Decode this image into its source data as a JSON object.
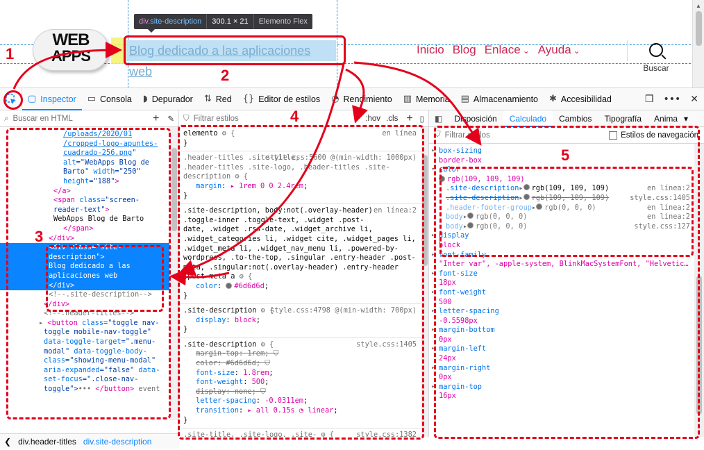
{
  "preview": {
    "logo_line1": "WEB",
    "logo_line2": "APPS",
    "site_description": "Blog dedicado a las aplicaciones web",
    "tooltip": {
      "tag": "div",
      "class": ".site-description",
      "size": "300.1 × 21",
      "type": "Elemento Flex"
    },
    "menu": [
      {
        "label": "Inicio",
        "has_arrow": false
      },
      {
        "label": "Blog",
        "has_arrow": false
      },
      {
        "label": "Enlace",
        "has_arrow": true
      },
      {
        "label": "Ayuda",
        "has_arrow": true
      }
    ],
    "search_label": "Buscar"
  },
  "toolbar": {
    "tabs": [
      {
        "label": "Inspector",
        "icon": "inspector-icon",
        "glyph": "▢",
        "active": true
      },
      {
        "label": "Consola",
        "icon": "console-icon",
        "glyph": "▭",
        "active": false
      },
      {
        "label": "Depurador",
        "icon": "debugger-icon",
        "glyph": "◗",
        "active": false
      },
      {
        "label": "Red",
        "icon": "network-icon",
        "glyph": "⇅",
        "active": false
      },
      {
        "label": "Editor de estilos",
        "icon": "style-editor-icon",
        "glyph": "{}",
        "active": false
      },
      {
        "label": "Rendimiento",
        "icon": "performance-icon",
        "glyph": "◔",
        "active": false
      },
      {
        "label": "Memoria",
        "icon": "memory-icon",
        "glyph": "▥",
        "active": false
      },
      {
        "label": "Almacenamiento",
        "icon": "storage-icon",
        "glyph": "▤",
        "active": false
      },
      {
        "label": "Accesibilidad",
        "icon": "accessibility-icon",
        "glyph": "✱",
        "active": false
      }
    ]
  },
  "html_panel": {
    "search_placeholder": "Buscar en HTML",
    "lines": [
      {
        "indent": 13,
        "parts": [
          {
            "t": "/uploads/2020/01",
            "c": "link-c"
          }
        ]
      },
      {
        "indent": 13,
        "parts": [
          {
            "t": "/cropped-logo-apuntes-",
            "c": "link-c"
          }
        ]
      },
      {
        "indent": 13,
        "parts": [
          {
            "t": "cuadrado-256.png",
            "c": "link-c"
          },
          {
            "t": "\"",
            "c": "val-c"
          }
        ]
      },
      {
        "indent": 13,
        "parts": [
          {
            "t": "alt",
            "c": "attr-c"
          },
          {
            "t": "=\"WebApps Blog de",
            "c": "val-c"
          }
        ]
      },
      {
        "indent": 13,
        "parts": [
          {
            "t": "Barto\"",
            "c": "val-c"
          },
          {
            "t": " width",
            "c": "attr-c"
          },
          {
            "t": "=\"250\"",
            "c": "val-c"
          }
        ]
      },
      {
        "indent": 13,
        "parts": [
          {
            "t": "height",
            "c": "attr-c"
          },
          {
            "t": "=\"188\"",
            "c": "val-c"
          },
          {
            "t": ">",
            "c": "tag-c"
          }
        ]
      },
      {
        "indent": 11,
        "parts": [
          {
            "t": "</a>",
            "c": "tag-c"
          }
        ]
      },
      {
        "indent": 11,
        "parts": [
          {
            "t": "<span ",
            "c": "tag-c"
          },
          {
            "t": "class",
            "c": "attr-c"
          },
          {
            "t": "=\"screen-",
            "c": "val-c"
          }
        ]
      },
      {
        "indent": 11,
        "parts": [
          {
            "t": "reader-text\"",
            "c": "val-c"
          },
          {
            "t": ">",
            "c": "tag-c"
          }
        ]
      },
      {
        "indent": 11,
        "parts": [
          {
            "t": "WebApps Blog de Barto",
            "c": "sel-c"
          }
        ]
      },
      {
        "indent": 13,
        "parts": [
          {
            "t": "</span>",
            "c": "tag-c"
          }
        ]
      },
      {
        "indent": 10,
        "parts": [
          {
            "t": "</div>",
            "c": "tag-c"
          }
        ]
      },
      {
        "indent": 10,
        "selected": true,
        "parts": [
          {
            "t": "<div class=\"site-",
            "c": ""
          }
        ]
      },
      {
        "indent": 10,
        "selected": true,
        "parts": [
          {
            "t": "description\">",
            "c": ""
          }
        ]
      },
      {
        "indent": 10,
        "selected": true,
        "parts": [
          {
            "t": "Blog dedicado a las",
            "c": ""
          }
        ]
      },
      {
        "indent": 10,
        "selected": true,
        "parts": [
          {
            "t": "aplicaciones web",
            "c": ""
          }
        ]
      },
      {
        "indent": 10,
        "selected": true,
        "parts": [
          {
            "t": "</div>",
            "c": ""
          }
        ]
      },
      {
        "indent": 10,
        "parts": [
          {
            "t": "<!--.site-description-->",
            "c": "gray-c"
          }
        ]
      },
      {
        "indent": 9,
        "parts": [
          {
            "t": "</div>",
            "c": "tag-c"
          }
        ]
      },
      {
        "indent": 9,
        "parts": [
          {
            "t": "<!--.header-titles-->",
            "c": "gray-c"
          }
        ]
      },
      {
        "indent": 8,
        "parts": [
          {
            "t": "▸ ",
            "c": "gray-c"
          },
          {
            "t": "<button ",
            "c": "tag-c"
          },
          {
            "t": "class",
            "c": "attr-c"
          },
          {
            "t": "=\"toggle nav-",
            "c": "val-c"
          }
        ]
      },
      {
        "indent": 9,
        "parts": [
          {
            "t": "toggle mobile-nav-toggle\"",
            "c": "val-c"
          }
        ]
      },
      {
        "indent": 9,
        "parts": [
          {
            "t": "data-toggle-target",
            "c": "attr-c"
          },
          {
            "t": "=\".menu-",
            "c": "val-c"
          }
        ]
      },
      {
        "indent": 9,
        "parts": [
          {
            "t": "modal\"",
            "c": "val-c"
          },
          {
            "t": " data-toggle-body-",
            "c": "attr-c"
          }
        ]
      },
      {
        "indent": 9,
        "parts": [
          {
            "t": "class",
            "c": "attr-c"
          },
          {
            "t": "=\"showing-menu-modal\"",
            "c": "val-c"
          }
        ]
      },
      {
        "indent": 9,
        "parts": [
          {
            "t": "aria-expanded",
            "c": "attr-c"
          },
          {
            "t": "=\"false\"",
            "c": "val-c"
          },
          {
            "t": " data-",
            "c": "attr-c"
          }
        ]
      },
      {
        "indent": 9,
        "parts": [
          {
            "t": "set-focus",
            "c": "attr-c"
          },
          {
            "t": "=\".close-nav-",
            "c": "val-c"
          }
        ]
      },
      {
        "indent": 9,
        "parts": [
          {
            "t": "toggle\">",
            "c": "val-c"
          },
          {
            "t": "••• ",
            "c": "gray-c"
          },
          {
            "t": "</button> ",
            "c": "tag-c"
          },
          {
            "t": "event",
            "c": "gray-c"
          }
        ]
      }
    ],
    "breadcrumbs": [
      "div.header-titles",
      "div.site-description"
    ]
  },
  "rules_panel": {
    "filter_placeholder": "Filtrar estilos",
    "hov": ":hov",
    "cls": ".cls",
    "rules": [
      {
        "selector": "elemento",
        "source": "en línea",
        "decls": []
      },
      {
        "selector": ".header-titles .site-title,\n.header-titles .site-logo, .header-titles .site-\ndescription",
        "source": "style.css:5600 @(min-width: 1000px)",
        "decls": [
          {
            "p": "margin",
            "v": "▸ 1rem 0 0 2.4rem",
            "struck": false
          }
        ]
      },
      {
        "selector": ".site-description, body:not(.overlay-header)\n.toggle-inner .toggle-text, .widget .post-\ndate, .widget .rss-date, .widget_archive li,\n.widget_categories li, .widget cite, .widget_pages li,\n.widget_meta li, .widget_nav_menu li, .powered-by-\nwordpress, .to-the-top, .singular .entry-header .post-\nmeta, .singular:not(.overlay-header) .entry-header\n.post-meta a",
        "source": "en línea:2",
        "decls": [
          {
            "p": "color",
            "v": "#6d6d6d",
            "swatch": true,
            "struck": false
          }
        ]
      },
      {
        "selector": ".site-description",
        "source": "style.css:4798 @(min-width: 700px)",
        "decls": [
          {
            "p": "display",
            "v": "block",
            "struck": false
          }
        ]
      },
      {
        "selector": ".site-description",
        "source": "style.css:1405",
        "decls": [
          {
            "p": "margin-top",
            "v": "1rem",
            "struck": true
          },
          {
            "p": "color",
            "v": "#6d6d6d",
            "struck": true
          },
          {
            "p": "font-size",
            "v": "1.8rem",
            "struck": false
          },
          {
            "p": "font-weight",
            "v": "500",
            "struck": false
          },
          {
            "p": "display",
            "v": "none",
            "struck": true
          },
          {
            "p": "letter-spacing",
            "v": "-0.0311em",
            "struck": false
          },
          {
            "p": "transition",
            "v": "▸ all 0.15s ◔ linear",
            "struck": false
          }
        ]
      },
      {
        "selector": ".site-title, .site-logo, .site-",
        "source": "style.css:1382",
        "decls": []
      }
    ]
  },
  "computed_panel": {
    "tabs": [
      "Disposición",
      "Calculado",
      "Cambios",
      "Tipografía",
      "Anima"
    ],
    "active_tab": "Calculado",
    "filter_placeholder": "Filtrar estilos",
    "browser_styles_label": "Estilos de navegación",
    "items": [
      {
        "name": "box-sizing",
        "value": "border-box"
      },
      {
        "name": "color",
        "value": "rgb(109, 109, 109)",
        "swatch": true,
        "expanded": true,
        "matches": [
          {
            "sel": ".site-description",
            "val": "rgb(109, 109, 109)",
            "loc": "en línea:2",
            "struck": false,
            "dim": false
          },
          {
            "sel": ".site-description",
            "val": "rgb(109, 109, 109)",
            "loc": "style.css:1405",
            "struck": true,
            "dim": false
          },
          {
            "sel": ".header-footer-group",
            "val": "rgb(0, 0, 0)",
            "loc": "en línea:2",
            "struck": false,
            "dim": true
          },
          {
            "sel": "body",
            "val": "rgb(0, 0, 0)",
            "loc": "en línea:2",
            "struck": false,
            "dim": true
          },
          {
            "sel": "body",
            "val": "rgb(0, 0, 0)",
            "loc": "style.css:127",
            "struck": false,
            "dim": true
          }
        ]
      },
      {
        "name": "display",
        "value": "block"
      },
      {
        "name": "font-family",
        "value": "\"Inter var\", -apple-system, BlinkMacSystemFont, \"Helvetic…"
      },
      {
        "name": "font-size",
        "value": "18px"
      },
      {
        "name": "font-weight",
        "value": "500"
      },
      {
        "name": "letter-spacing",
        "value": "-0.5598px"
      },
      {
        "name": "margin-bottom",
        "value": "0px"
      },
      {
        "name": "margin-left",
        "value": "24px"
      },
      {
        "name": "margin-right",
        "value": "0px"
      },
      {
        "name": "margin-top",
        "value": "16px"
      }
    ]
  },
  "annotations": {
    "n1": "1",
    "n2": "2",
    "n3": "3",
    "n4": "4",
    "n5": "5",
    "color": "#e3001b"
  }
}
